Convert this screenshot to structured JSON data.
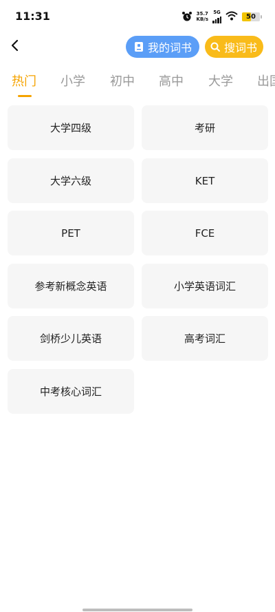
{
  "status": {
    "time": "11:31",
    "speed_value": "35.7",
    "speed_unit": "KB/s",
    "network": "5G",
    "battery": "50",
    "battery_level": 0.5
  },
  "header": {
    "back_icon": "chevron-left-icon",
    "my_books_label": "我的词书",
    "search_label": "搜词书",
    "colors": {
      "blue": "#5b9ef7",
      "yellow": "#f9bb1a"
    }
  },
  "tabs": [
    {
      "label": "热门",
      "active": true
    },
    {
      "label": "小学",
      "active": false
    },
    {
      "label": "初中",
      "active": false
    },
    {
      "label": "高中",
      "active": false
    },
    {
      "label": "大学",
      "active": false
    },
    {
      "label": "出国",
      "active": false
    }
  ],
  "books": [
    "大学四级",
    "考研",
    "大学六级",
    "KET",
    "PET",
    "FCE",
    "参考新概念英语",
    "小学英语词汇",
    "剑桥少儿英语",
    "高考词汇",
    "中考核心词汇"
  ],
  "accent_color": "#f5a300"
}
